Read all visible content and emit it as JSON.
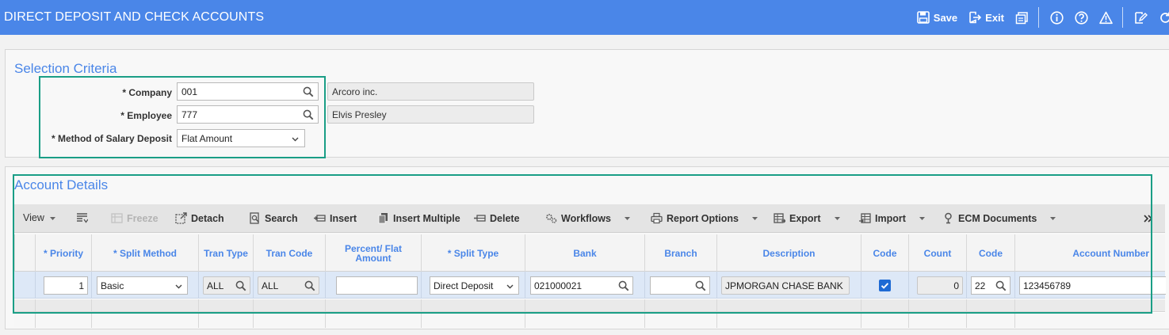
{
  "header": {
    "title": "DIRECT DEPOSIT AND CHECK ACCOUNTS",
    "save_label": "Save",
    "exit_label": "Exit"
  },
  "selection": {
    "title": "Selection Criteria",
    "company": {
      "label": "* Company",
      "value": "001",
      "name": "Arcoro inc."
    },
    "employee": {
      "label": "* Employee",
      "value": "777",
      "name": "Elvis Presley"
    },
    "method": {
      "label": "* Method of Salary Deposit",
      "value": "Flat Amount"
    }
  },
  "details": {
    "title": "Account Details",
    "toolbar": {
      "view": "View",
      "freeze": "Freeze",
      "detach": "Detach",
      "search": "Search",
      "insert": "Insert",
      "insert_multiple": "Insert Multiple",
      "delete": "Delete",
      "workflows": "Workflows",
      "report_options": "Report Options",
      "export": "Export",
      "import": "Import",
      "ecm_documents": "ECM Documents"
    },
    "columns": {
      "priority": "* Priority",
      "split_method": "* Split Method",
      "tran_type": "Tran Type",
      "tran_code": "Tran Code",
      "percent_flat": "Percent/ Flat Amount",
      "split_type": "* Split Type",
      "bank": "Bank",
      "branch": "Branch",
      "description": "Description",
      "code": "Code",
      "count": "Count",
      "code2": "Code",
      "account_number": "Account Number"
    },
    "row": {
      "priority": "1",
      "split_method": "Basic",
      "tran_type": "ALL",
      "tran_code": "ALL",
      "percent_flat": "",
      "split_type": "Direct Deposit",
      "bank": "021000021",
      "branch": "",
      "description": "JPMORGAN CHASE BANK",
      "code_checked": true,
      "count": "0",
      "code2": "22",
      "account_number": "123456789"
    }
  },
  "colors": {
    "header_bg": "#4a86e8",
    "accent": "#4a86e8",
    "highlight": "#1a9e86",
    "row_selected": "#dde8f7"
  }
}
